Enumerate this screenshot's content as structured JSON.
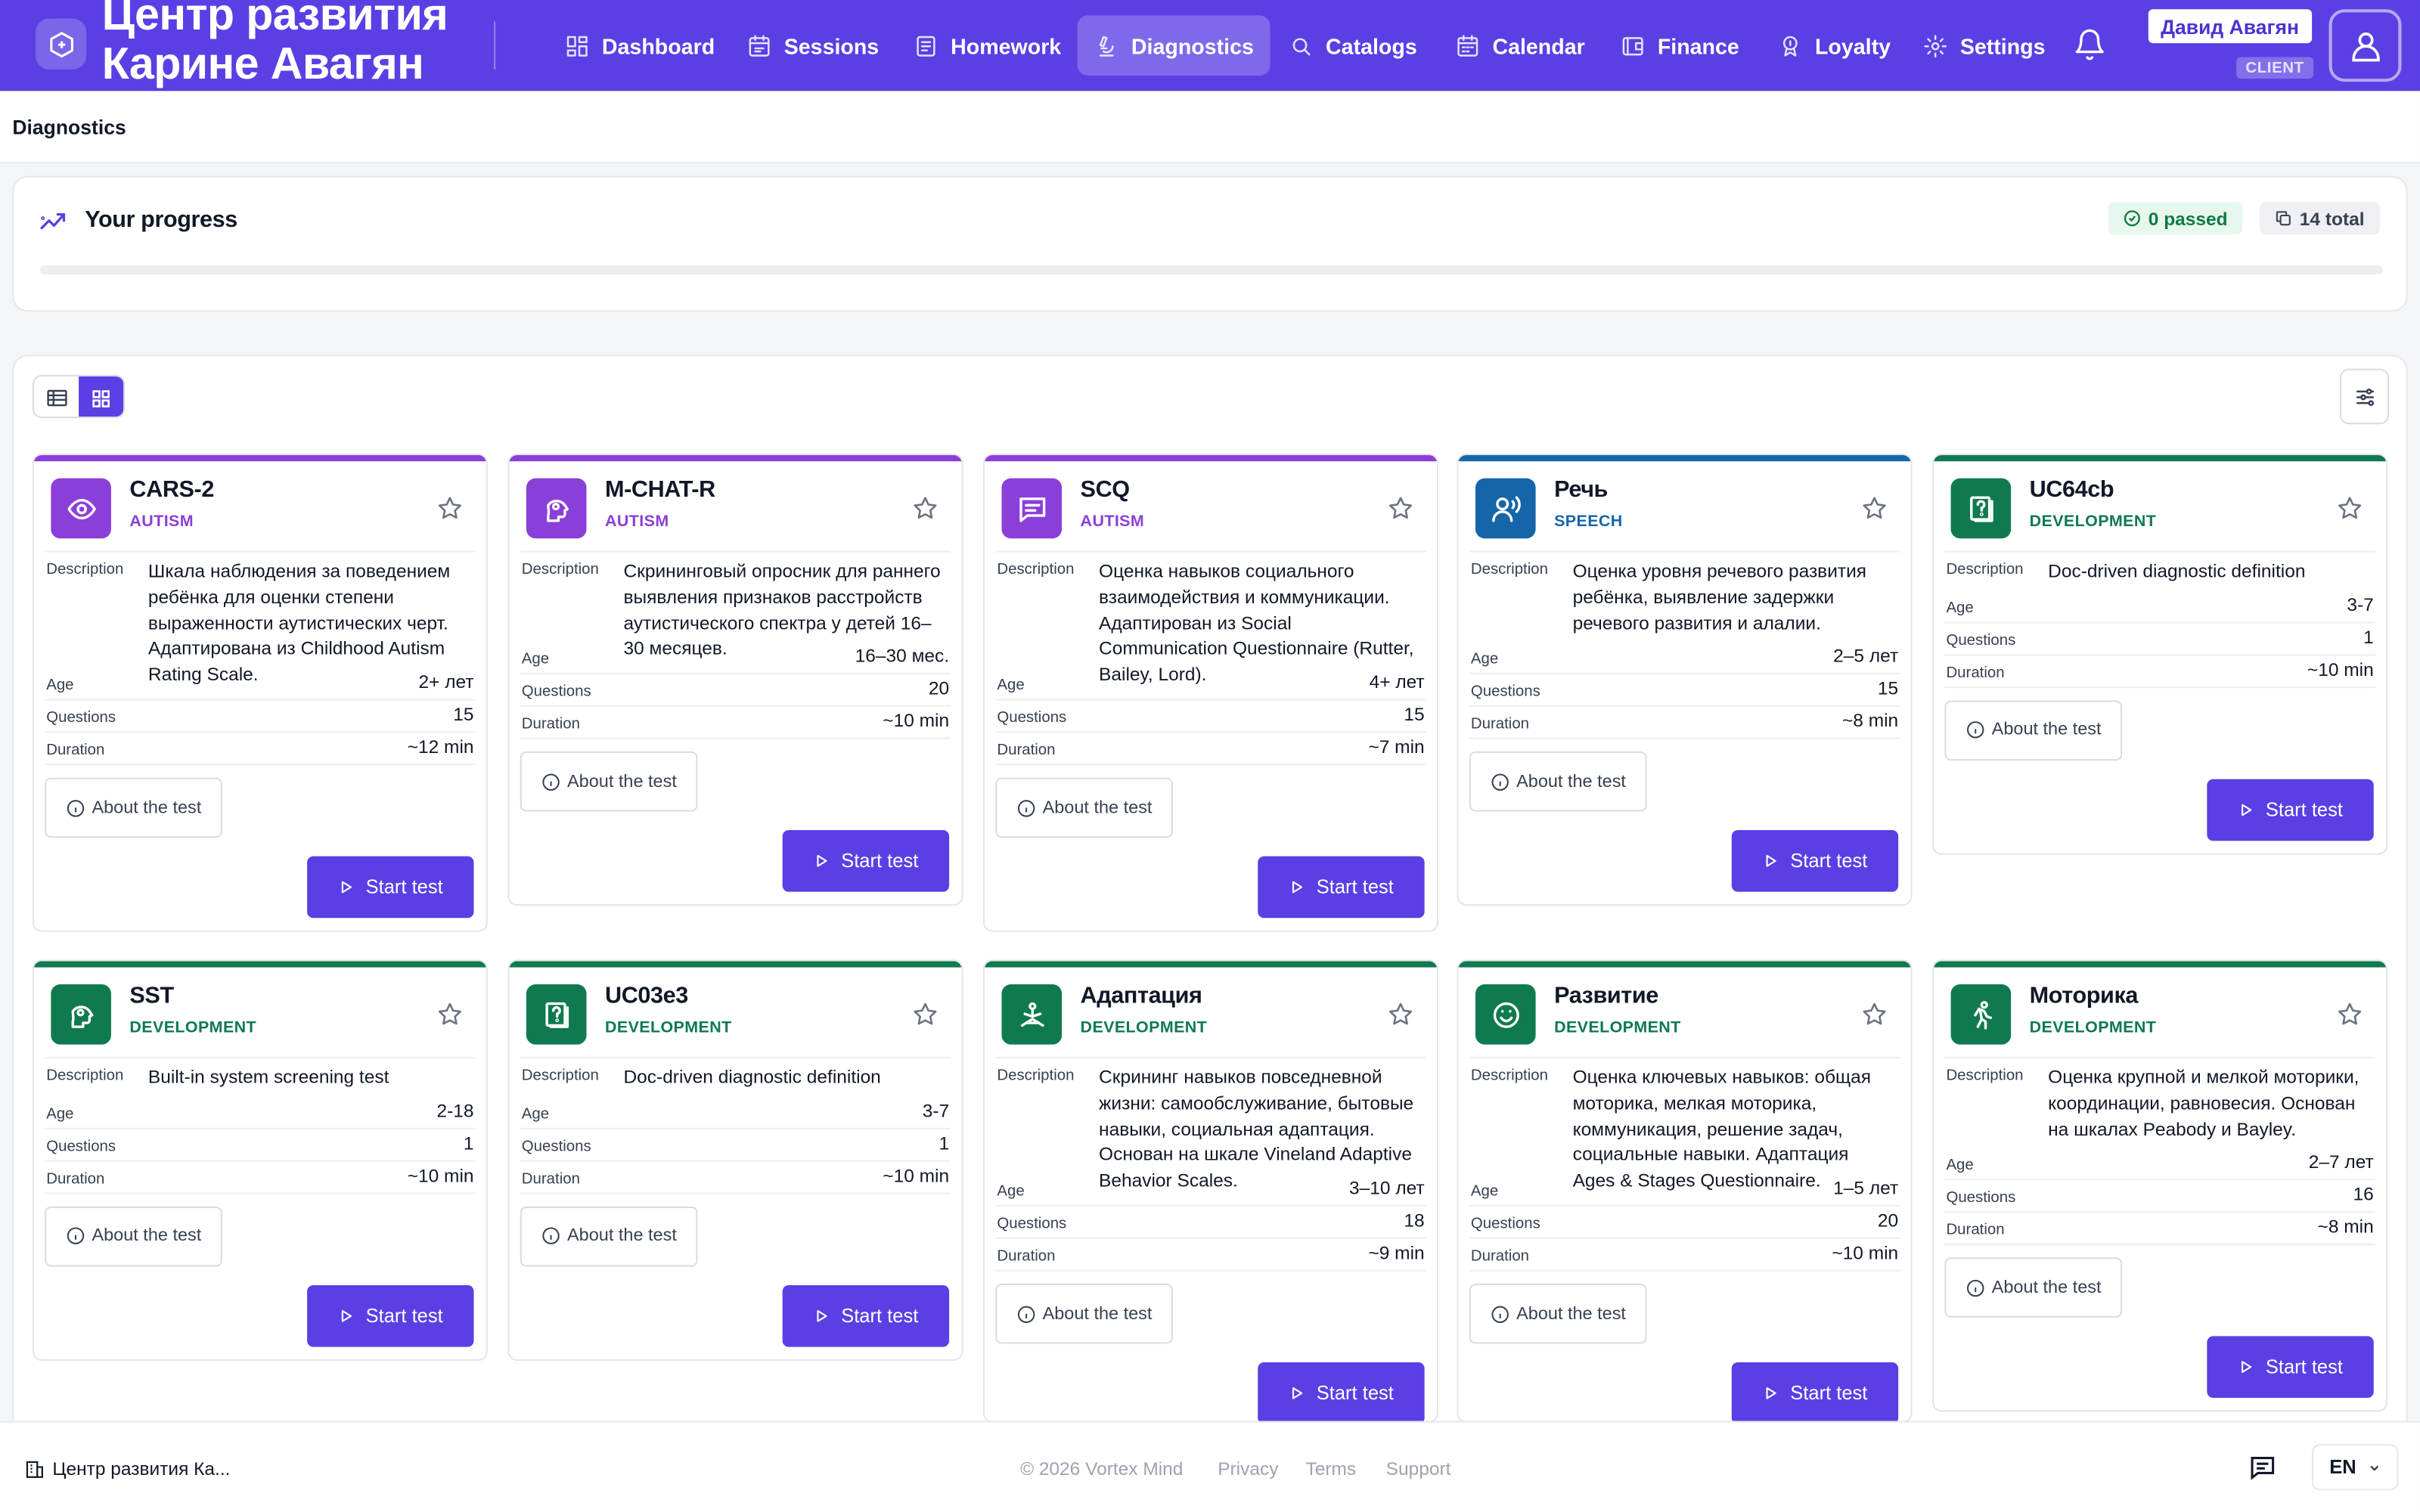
{
  "app": {
    "brand_line1": "Центр развития",
    "brand_line2": "Карине Авагян",
    "brand_color": "#5b3fe4"
  },
  "nav": [
    {
      "label": "Dashboard",
      "icon": "dashboard-icon",
      "active": false
    },
    {
      "label": "Sessions",
      "icon": "calendar-check-icon",
      "active": false
    },
    {
      "label": "Homework",
      "icon": "clipboard-icon",
      "active": false
    },
    {
      "label": "Diagnostics",
      "icon": "microscope-icon",
      "active": true
    },
    {
      "label": "Catalogs",
      "icon": "search-icon",
      "active": false
    },
    {
      "label": "Calendar",
      "icon": "calendar-icon",
      "active": false
    },
    {
      "label": "Finance",
      "icon": "wallet-icon",
      "active": false
    },
    {
      "label": "Loyalty",
      "icon": "award-icon",
      "active": false
    },
    {
      "label": "Settings",
      "icon": "gear-icon",
      "active": false
    }
  ],
  "user": {
    "name": "Давид Авагян",
    "role": "CLIENT"
  },
  "page": {
    "title": "Diagnostics"
  },
  "progress": {
    "title": "Your progress",
    "passed_label": "0 passed",
    "total_label": "14 total",
    "fraction": 0
  },
  "labels": {
    "description": "Description",
    "age": "Age",
    "questions": "Questions",
    "duration": "Duration",
    "about": "About the test",
    "start": "Start test"
  },
  "category_colors": {
    "AUTISM": "#8b3fd9",
    "SPEECH": "#1565a8",
    "DEVELOPMENT": "#0f7a4f"
  },
  "tests": [
    {
      "name": "CARS-2",
      "category": "AUTISM",
      "icon": "eye-icon",
      "description": "Шкала наблюдения за поведением ребёнка для оценки степени выраженности аутистических черт. Адаптирована из Childhood Autism Rating Scale.",
      "age": "2+ лет",
      "questions": "15",
      "duration": "~12 min"
    },
    {
      "name": "M-CHAT-R",
      "category": "AUTISM",
      "icon": "head-gear-icon",
      "description": "Скрининговый опросник для раннего выявления признаков расстройств аутистического спектра у детей 16–30 месяцев.",
      "age": "16–30 мес.",
      "questions": "20",
      "duration": "~10 min"
    },
    {
      "name": "SCQ",
      "category": "AUTISM",
      "icon": "chat-icon",
      "description": "Оценка навыков социального взаимодействия и коммуникации. Адаптирован из Social Communication Questionnaire (Rutter, Bailey, Lord).",
      "age": "4+ лет",
      "questions": "15",
      "duration": "~7 min"
    },
    {
      "name": "Речь",
      "category": "SPEECH",
      "icon": "speaking-icon",
      "description": "Оценка уровня речевого развития ребёнка, выявление задержки речевого развития и алалии.",
      "age": "2–5 лет",
      "questions": "15",
      "duration": "~8 min"
    },
    {
      "name": "UC64cb",
      "category": "DEVELOPMENT",
      "icon": "question-doc-icon",
      "description": "Doc-driven diagnostic definition",
      "age": "3-7",
      "questions": "1",
      "duration": "~10 min"
    },
    {
      "name": "SST",
      "category": "DEVELOPMENT",
      "icon": "head-gear-icon",
      "description": "Built-in system screening test",
      "age": "2-18",
      "questions": "1",
      "duration": "~10 min"
    },
    {
      "name": "UC03e3",
      "category": "DEVELOPMENT",
      "icon": "question-doc-icon",
      "description": "Doc-driven diagnostic definition",
      "age": "3-7",
      "questions": "1",
      "duration": "~10 min"
    },
    {
      "name": "Адаптация",
      "category": "DEVELOPMENT",
      "icon": "meditation-icon",
      "description": "Скрининг навыков повседневной жизни: самообслуживание, бытовые навыки, социальная адаптация. Основан на шкале Vineland Adaptive Behavior Scales.",
      "age": "3–10 лет",
      "questions": "18",
      "duration": "~9 min"
    },
    {
      "name": "Развитие",
      "category": "DEVELOPMENT",
      "icon": "smile-icon",
      "description": "Оценка ключевых навыков: общая моторика, мелкая моторика, коммуникация, решение задач, социальные навыки. Адаптация Ages & Stages Questionnaire.",
      "age": "1–5 лет",
      "questions": "20",
      "duration": "~10 min"
    },
    {
      "name": "Моторика",
      "category": "DEVELOPMENT",
      "icon": "running-icon",
      "description": "Оценка крупной и мелкой моторики, координации, равновесия. Основан на шкалах Peabody и Bayley.",
      "age": "2–7 лет",
      "questions": "16",
      "duration": "~8 min"
    }
  ],
  "footer": {
    "org": "Центр развития Ка...",
    "copyright": "© 2026 Vortex Mind",
    "privacy": "Privacy",
    "terms": "Terms",
    "support": "Support",
    "lang": "EN"
  }
}
